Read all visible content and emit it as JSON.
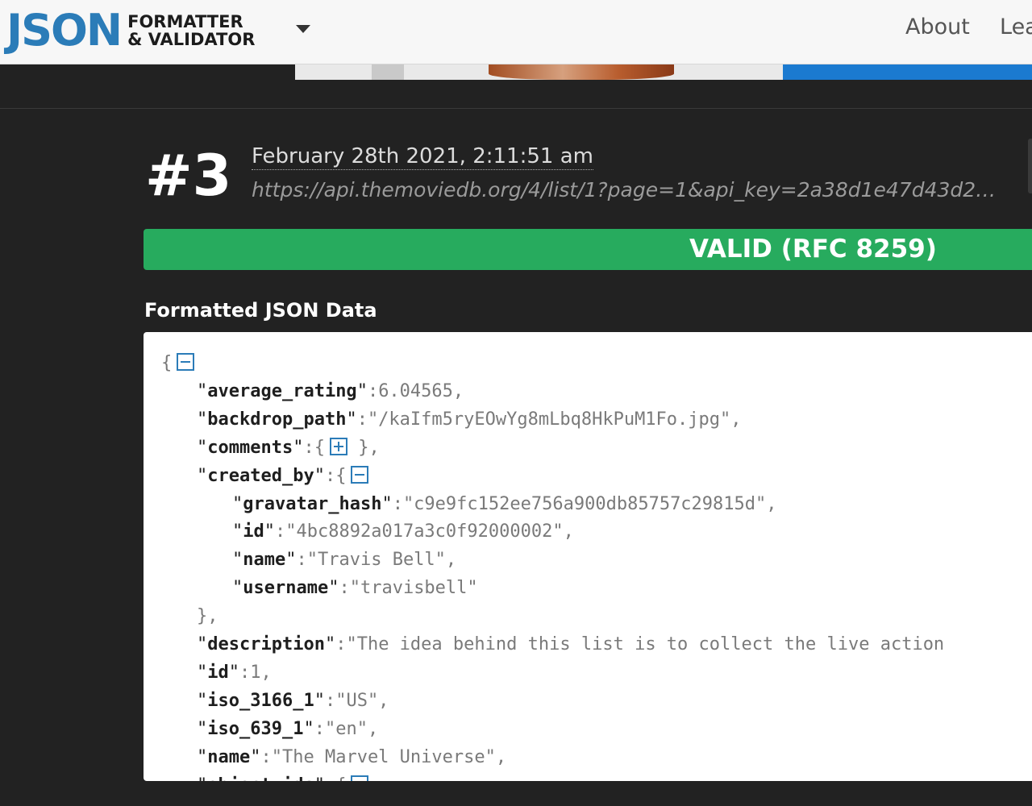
{
  "header": {
    "logo_main": "JSON",
    "logo_line1": "FORMATTER",
    "logo_line2": "& VALIDATOR",
    "nav": [
      "About",
      "Lea"
    ]
  },
  "result": {
    "number": "#3",
    "timestamp": "February 28th 2021, 2:11:51 am",
    "url": "https://api.themoviedb.org/4/list/1?page=1&api_key=2a38d1e47d43d2a…",
    "status": "VALID (RFC 8259)",
    "section_title": "Formatted JSON Data"
  },
  "json_lines": [
    {
      "open": "{",
      "toggle": "collapse"
    },
    {
      "key": "average_rating",
      "value": "6.04565,"
    },
    {
      "key": "backdrop_path",
      "value": "\"/kaIfm5ryEOwYg8mLbq8HkPuM1Fo.jpg\","
    },
    {
      "key": "comments",
      "value": "{",
      "toggle": "expand",
      "after": "},"
    },
    {
      "key": "created_by",
      "value": "{",
      "toggle": "collapse"
    },
    {
      "key": "gravatar_hash",
      "value": "\"c9e9fc152ee756a900db85757c29815d\","
    },
    {
      "key": "id",
      "value": "\"4bc8892a017a3c0f92000002\","
    },
    {
      "key": "name",
      "value": "\"Travis Bell\","
    },
    {
      "key": "username",
      "value": "\"travisbell\""
    },
    {
      "close": "},"
    },
    {
      "key": "description",
      "value": "\"The idea behind this list is to collect the live action"
    },
    {
      "key": "id",
      "value": "1,"
    },
    {
      "key": "iso_3166_1",
      "value": "\"US\","
    },
    {
      "key": "iso_639_1",
      "value": "\"en\","
    },
    {
      "key": "name",
      "value": "\"The Marvel Universe\","
    },
    {
      "key": "object_ids",
      "value": "{",
      "toggle": "collapse"
    }
  ],
  "colors": {
    "logo_blue": "#2b7cb8",
    "valid_green": "#27ab5e",
    "page_bg": "#222222"
  }
}
